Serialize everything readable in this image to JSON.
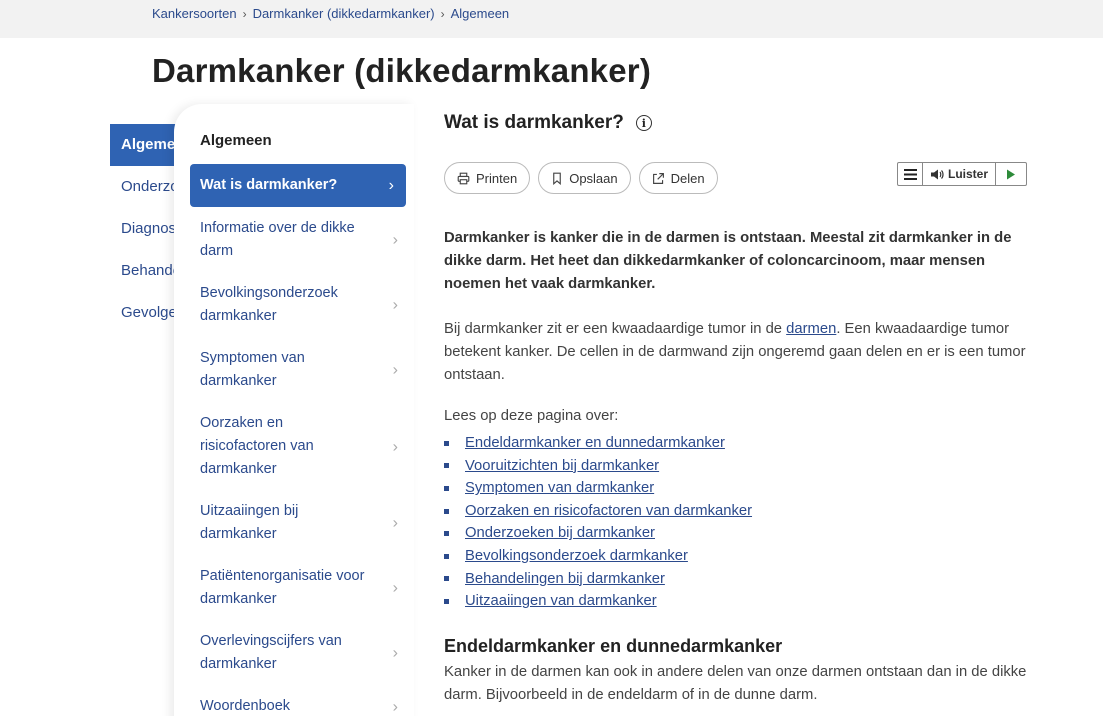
{
  "breadcrumb": [
    "Kankersoorten",
    "Darmkanker (dikkedarmkanker)",
    "Algemeen"
  ],
  "page_title": "Darmkanker (dikkedarmkanker)",
  "left_nav": [
    "Algemeen",
    "Onderzoeken",
    "Diagnose",
    "Behandelingen",
    "Gevolgen"
  ],
  "submenu": {
    "heading": "Algemeen",
    "active": "Wat is darmkanker?",
    "items": [
      "Informatie over de dikke darm",
      "Bevolkingsonderzoek darmkanker",
      "Symptomen van darmkanker",
      "Oorzaken en risicofactoren van darmkanker",
      "Uitzaaiingen bij darmkanker",
      "Patiëntenorganisatie voor darmkanker",
      "Overlevingscijfers van darmkanker",
      "Woordenboek"
    ]
  },
  "content": {
    "heading": "Wat is darmkanker?",
    "info_icon": "info-icon",
    "toolbar": {
      "print": "Printen",
      "save": "Opslaan",
      "share": "Delen"
    },
    "listen": {
      "label": "Luister"
    },
    "intro": "Darmkanker is kanker die in de darmen is ontstaan. Meestal zit darmkanker in de dikke darm. Het heet dan dikkedarmkanker of coloncarcinoom, maar mensen noemen het vaak darmkanker.",
    "para1_before": "Bij darmkanker zit er een kwaadaardige tumor in de ",
    "para1_link": "darmen",
    "para1_after": ". Een kwaadaardige tumor betekent kanker. De cellen in de darmwand zijn ongeremd gaan delen en er is een tumor ontstaan.",
    "lees": "Lees op deze pagina over:",
    "links": [
      "Endeldarmkanker en dunnedarmkanker",
      "Vooruitzichten bij darmkanker",
      "Symptomen van darmkanker",
      "Oorzaken en risicofactoren van darmkanker",
      "Onderzoeken bij darmkanker",
      "Bevolkingsonderzoek darmkanker",
      "Behandelingen bij darmkanker",
      "Uitzaaiingen van darmkanker"
    ],
    "section_title": "Endeldarmkanker en dunnedarmkanker",
    "para2": "Kanker in de darmen kan ook in andere delen van onze darmen ontstaan dan in de dikke darm. Bijvoorbeeld in de endeldarm of in de dunne darm."
  },
  "colors": {
    "primary": "#2f63b3",
    "link": "#2b4a8c"
  }
}
